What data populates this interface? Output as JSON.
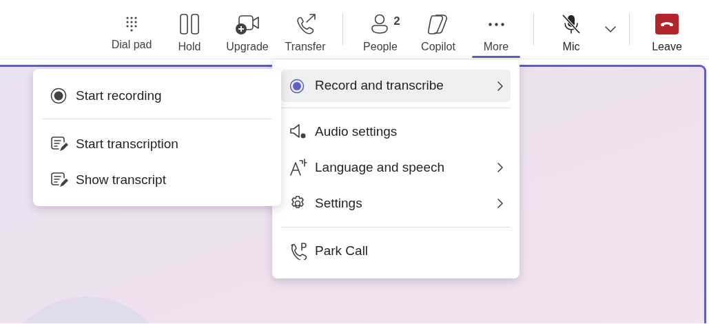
{
  "toolbar": {
    "groups": [
      [
        {
          "label": "Dial pad",
          "selected": false
        },
        {
          "label": "Hold",
          "selected": false
        },
        {
          "label": "Upgrade",
          "selected": false
        },
        {
          "label": "Transfer",
          "selected": false
        }
      ],
      [
        {
          "label": "People",
          "badge": "2",
          "selected": false
        },
        {
          "label": "Copilot",
          "selected": false
        },
        {
          "label": "More",
          "selected": true
        }
      ],
      [
        {
          "label": "Mic",
          "muted": true,
          "dropdown": true,
          "selected": false
        }
      ],
      [
        {
          "label": "Leave",
          "kind": "danger",
          "selected": false
        }
      ]
    ]
  },
  "more_menu": {
    "sections": [
      [
        {
          "label": "Record and transcribe",
          "submenu": true,
          "selected": true
        }
      ],
      [
        {
          "label": "Audio settings",
          "submenu": false,
          "selected": false
        },
        {
          "label": "Language and speech",
          "submenu": true,
          "selected": false
        },
        {
          "label": "Settings",
          "submenu": true,
          "selected": false
        }
      ],
      [
        {
          "label": "Park Call",
          "submenu": false,
          "selected": false
        }
      ]
    ]
  },
  "record_submenu": {
    "sections": [
      [
        {
          "label": "Start recording"
        }
      ],
      [
        {
          "label": "Start transcription"
        },
        {
          "label": "Show transcript"
        }
      ]
    ]
  }
}
